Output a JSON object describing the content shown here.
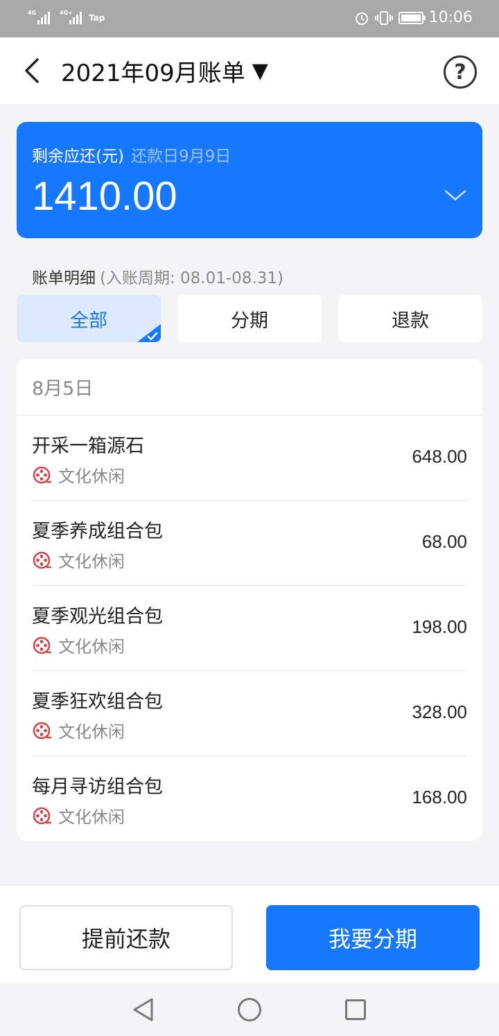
{
  "status_bar": {
    "signal1": "4G",
    "signal2": "4G+",
    "carrier": "Tap",
    "battery_level": 1.0,
    "time": "10:06"
  },
  "header": {
    "title": "2021年09月账单",
    "caret": "▼",
    "help_icon": "question-circle-icon",
    "help_glyph": "?"
  },
  "summary": {
    "label": "剩余应还(元)",
    "due_date": "还款日9月9日",
    "amount": "1410.00"
  },
  "details": {
    "title": "账单明细",
    "period": "(入账周期: 08.01-08.31)"
  },
  "tabs": [
    {
      "label": "全部",
      "active": true
    },
    {
      "label": "分期",
      "active": false
    },
    {
      "label": "退款",
      "active": false
    }
  ],
  "list": {
    "date": "8月5日",
    "items": [
      {
        "name": "开采一箱源石",
        "category": "文化休闲",
        "amount": "648.00"
      },
      {
        "name": "夏季养成组合包",
        "category": "文化休闲",
        "amount": "68.00"
      },
      {
        "name": "夏季观光组合包",
        "category": "文化休闲",
        "amount": "198.00"
      },
      {
        "name": "夏季狂欢组合包",
        "category": "文化休闲",
        "amount": "328.00"
      },
      {
        "name": "每月寻访组合包",
        "category": "文化休闲",
        "amount": "168.00"
      }
    ]
  },
  "actions": {
    "prepay": "提前还款",
    "installment": "我要分期"
  },
  "colors": {
    "accent": "#1677ff",
    "category_icon": "#d9414b"
  }
}
